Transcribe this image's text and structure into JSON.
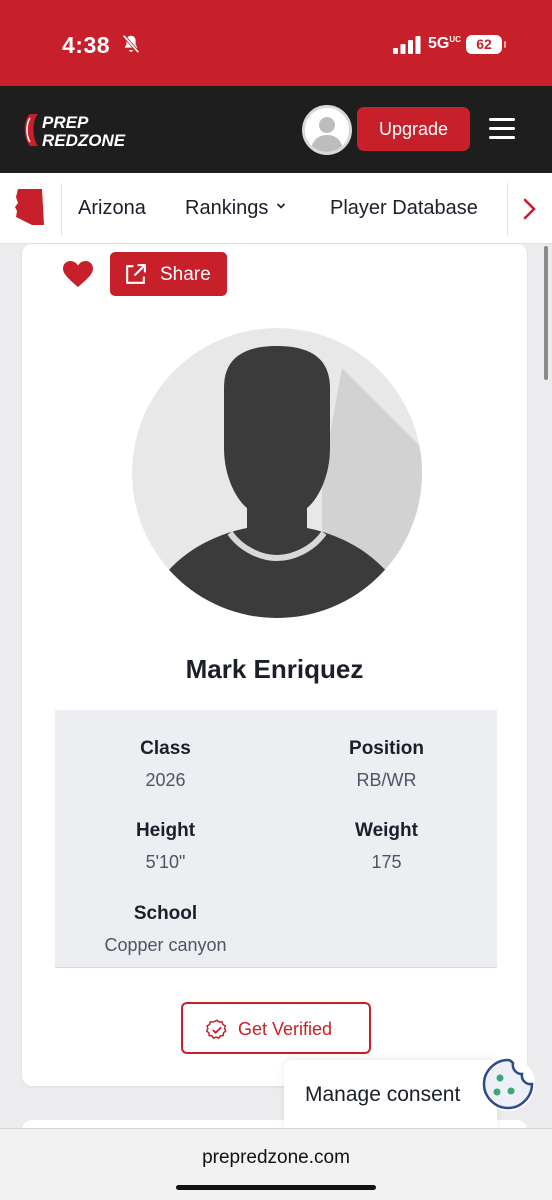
{
  "status_bar": {
    "time": "4:38",
    "network": "5G",
    "network_suffix": "UC",
    "battery": "62"
  },
  "header": {
    "logo_line1": "PREP",
    "logo_line2": "REDZONE",
    "upgrade_label": "Upgrade"
  },
  "nav": {
    "items": [
      {
        "label": "Arizona"
      },
      {
        "label": "Rankings"
      },
      {
        "label": "Player Database"
      }
    ]
  },
  "profile": {
    "share_label": "Share",
    "name": "Mark Enriquez",
    "fields": {
      "class": {
        "label": "Class",
        "value": "2026"
      },
      "position": {
        "label": "Position",
        "value": "RB/WR"
      },
      "height": {
        "label": "Height",
        "value": "5'10\""
      },
      "weight": {
        "label": "Weight",
        "value": "175"
      },
      "school": {
        "label": "School",
        "value": "Copper canyon"
      }
    },
    "verify_label": "Get Verified"
  },
  "consent": {
    "label": "Manage consent"
  },
  "browser": {
    "url": "prepredzone.com"
  },
  "colors": {
    "brand_red": "#c8202a",
    "header_dark": "#1e1e1e",
    "info_bg": "#edeef2"
  },
  "icons": [
    "bell-off-icon",
    "signal-icon",
    "menu-icon",
    "arizona-map-icon",
    "chevron-down-icon",
    "chevron-right-icon",
    "heart-icon",
    "share-icon",
    "verified-badge-icon",
    "cookie-icon"
  ]
}
